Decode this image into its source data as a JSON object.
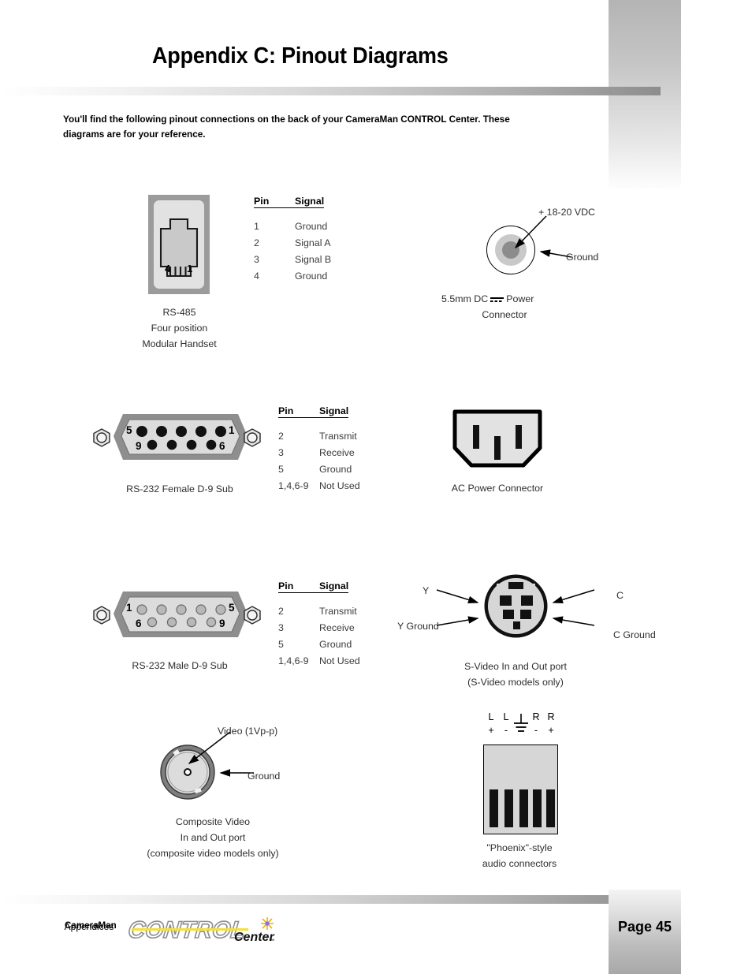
{
  "document": {
    "title": "Appendix C: Pinout Diagrams",
    "intro": "You'll find the following pinout connections on the back of your CameraMan CONTROL Center. These diagrams are for your reference."
  },
  "table_headers": {
    "pin": "Pin",
    "signal": "Signal"
  },
  "connectors": {
    "rs485": {
      "caption_line1": "RS-485",
      "caption_line2": "Four position",
      "caption_line3": "Modular Handset",
      "pin_labels": {
        "left": "4",
        "right": "1"
      },
      "rows": [
        {
          "pin": "1",
          "signal": "Ground"
        },
        {
          "pin": "2",
          "signal": "Signal A"
        },
        {
          "pin": "3",
          "signal": "Signal B"
        },
        {
          "pin": "4",
          "signal": "Ground"
        }
      ]
    },
    "dc_power": {
      "label_center": "+ 18-20 VDC",
      "label_outer": "Ground",
      "caption_line1_a": "5.5mm DC",
      "caption_line1_b": "Power",
      "caption_line2": "Connector"
    },
    "rs232_female": {
      "caption": "RS-232 Female D-9 Sub",
      "pin_labels": {
        "top_left": "5",
        "top_right": "1",
        "bottom_left": "9",
        "bottom_right": "6"
      },
      "rows": [
        {
          "pin": "2",
          "signal": "Transmit"
        },
        {
          "pin": "3",
          "signal": "Receive"
        },
        {
          "pin": "5",
          "signal": "Ground"
        },
        {
          "pin": "1,4,6-9",
          "signal": "Not Used"
        }
      ]
    },
    "ac_power": {
      "caption": "AC Power Connector"
    },
    "rs232_male": {
      "caption": "RS-232 Male D-9 Sub",
      "pin_labels": {
        "top_left": "1",
        "top_right": "5",
        "bottom_left": "6",
        "bottom_right": "9"
      },
      "rows": [
        {
          "pin": "2",
          "signal": "Transmit"
        },
        {
          "pin": "3",
          "signal": "Receive"
        },
        {
          "pin": "5",
          "signal": "Ground"
        },
        {
          "pin": "1,4,6-9",
          "signal": "Not Used"
        }
      ]
    },
    "svideo": {
      "label_y": "Y",
      "label_y_ground": "Y Ground",
      "label_c": "C",
      "label_c_ground": "C Ground",
      "caption_line1": "S-Video In and Out port",
      "caption_line2": "(S-Video models only)"
    },
    "composite_video": {
      "label_signal": "Video (1Vp-p)",
      "label_ground": "Ground",
      "caption_line1": "Composite Video",
      "caption_line2": "In and Out port",
      "caption_line3": "(composite video models only)"
    },
    "phoenix_audio": {
      "terminals_top": [
        "L",
        "L",
        "",
        "R",
        "R"
      ],
      "terminals_bottom": [
        "+",
        "-",
        "",
        "-",
        "+"
      ],
      "caption_line1": "\"Phoenix\"-style",
      "caption_line2": "audio connectors"
    }
  },
  "footer": {
    "brand": "CameraMan",
    "logo_primary": "CONTROL",
    "logo_secondary": "Center",
    "logo_tm": "™",
    "section": "Appendices",
    "page": "Page 45"
  },
  "colors": {
    "rail_gray": "#b4b4b4",
    "rule_dark": "#8d8d8d",
    "shell_gray": "#9b9b9b",
    "face_gray": "#d6d6d6",
    "logo_yellow": "#f5e03a"
  }
}
